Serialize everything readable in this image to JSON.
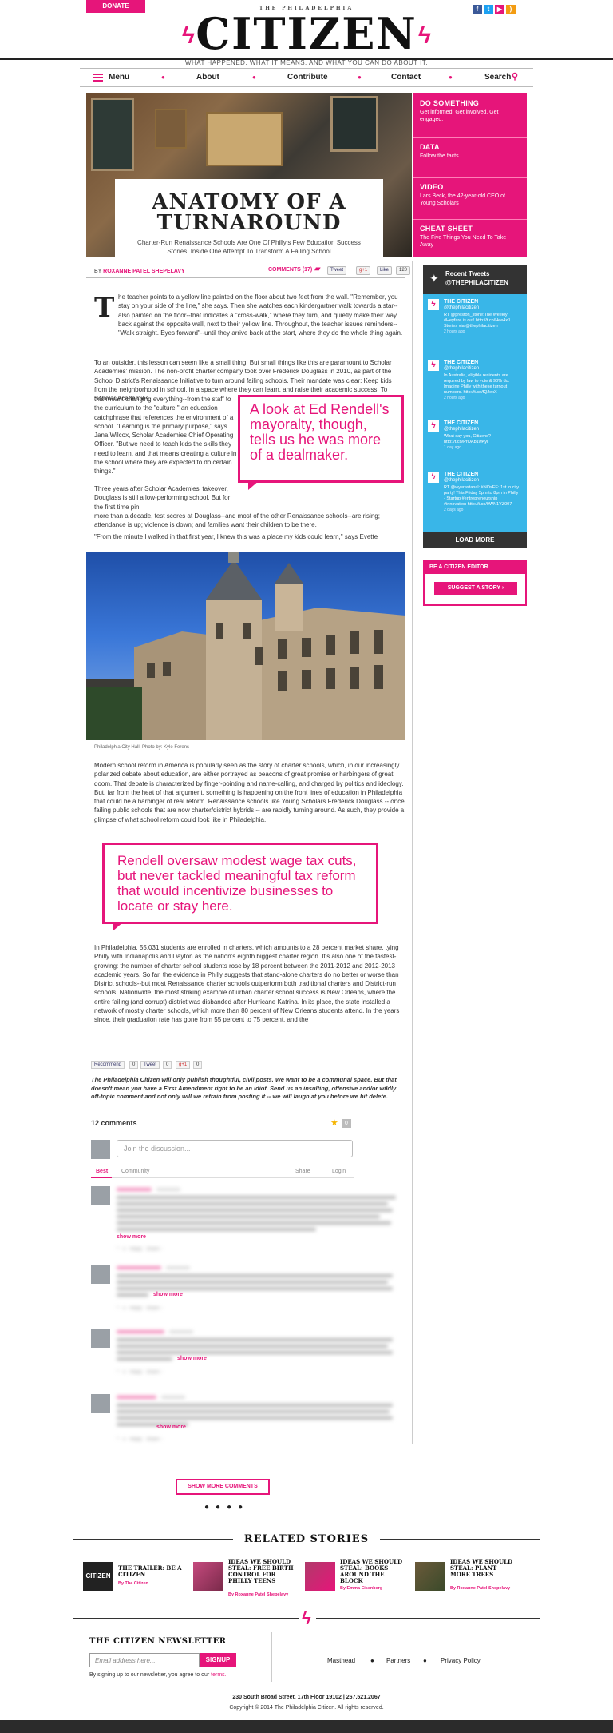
{
  "topbar": {
    "donate_label": "DONATE",
    "social": [
      {
        "name": "facebook-icon",
        "glyph": "f",
        "color": "#3b5998"
      },
      {
        "name": "twitter-icon",
        "glyph": "t",
        "color": "#1da1f2"
      },
      {
        "name": "youtube-icon",
        "glyph": "▶",
        "color": "#e6157a"
      },
      {
        "name": "rss-icon",
        "glyph": ")",
        "color": "#f39c12"
      }
    ]
  },
  "masthead": {
    "kicker": "THE PHILADELPHIA",
    "title": "CITIZEN",
    "tagline": "WHAT HAPPENED. WHAT IT MEANS. AND WHAT YOU CAN DO ABOUT IT."
  },
  "nav": {
    "menu": "Menu",
    "about": "About",
    "contribute": "Contribute",
    "contact": "Contact",
    "search": "Search"
  },
  "article": {
    "title_line1": "ANATOMY OF A",
    "title_line2": "TURNAROUND",
    "subtitle": "Charter-Run Renaissance Schools Are One Of Philly's Few Education Success Stories. Inside One Attempt To Transform A Failing School",
    "by_prefix": "BY",
    "author": "ROXANNE PATEL SHEPELAVY",
    "comments_label": "COMMENTS (17)",
    "tweet_label": "Tweet",
    "gplus_label": "g+1",
    "like_label": "Like",
    "like_count": "120",
    "dropcap": "T",
    "p1": "he teacher points to a yellow line painted on the floor about two feet from the wall. \"Remember, you stay on your side of the line,\" she says. Then she watches each kindergartner walk towards a star--also painted on the floor--that indicates a \"cross-walk,\" where they turn, and quietly make their way back against the opposite wall, next to their yellow line. Throughout, the teacher issues reminders--\"Walk straight. Eyes forward\"--until they arrive back at the start, where they do the whole thing again.",
    "p2a": "To an outsider, this lesson can seem like a small thing. But small things like this are paramount to Scholar Academies' mission. The non-profit charter company took over Frederick Douglass in 2010, as part of the School District's Renaissance Initiative to turn around failing schools. Their mandate was clear: Keep kids from the neighborhood in school, in a space where they can learn, and raise their academic success. To Scholar Academies,",
    "p2b": "this meant changing everything--from the staff to the curriculum to the \"culture,\" an education catchphrase that references the environment of a school. \"Learning is the primary purpose,\" says Jana Wilcox, Scholar Academies Chief Operating Officer. \"But we need to teach kids the skills they need to learn, and that means creating a culture in the school where they are expected to do certain things.\"",
    "p3a": "Three years after Scholar Academies' takeover, Douglass is still a low-performing school. But for the first time pin",
    "p3b": "more than a decade, test scores at Douglass--and most of the other Renaissance schools--are rising; attendance is up; violence is down; and families want their children to be there.",
    "p4": "\"From the minute I walked in that first year, I knew this was a place my kids could learn,\" says Evette",
    "pullquote1": "A look at Ed Rendell's mayoralty, though, tells us he was more of a dealmaker.",
    "photo_caption": "Philadelphia City Hall. Photo by: Kyle Ferens",
    "p5": "Modern school reform in America is popularly seen as the story of charter schools, which, in our increasingly polarized debate about education, are either portrayed as beacons of great promise or harbingers of great doom. That debate is characterized by finger-pointing and name-calling, and charged by politics and ideology. But, far from the heat of that argument, something is happening on the front lines of education in Philadelphia that could be a harbinger of real reform. Renaissance schools like Young Scholars Frederick Douglass -- once failing public schools that are now charter/district hybrids -- are rapidly turning around. As such, they provide a glimpse of what school reform could look like in Philadelphia.",
    "pullquote2": "Rendell oversaw modest wage tax cuts, but never tackled meaningful tax reform that would incentivize businesses to locate or stay here.",
    "p6": "In Philadelphia, 55,031 students are enrolled in charters, which amounts to a 28 percent market share, tying Philly with Indianapolis and Dayton as the nation's eighth biggest charter region. It's also one of the fastest-growing: the number of charter school students rose by 18 percent between the 2011-2012 and 2012-2013 academic years. So far, the evidence in Philly suggests that stand-alone charters do no better or worse than District schools--but most Renaissance charter schools outperform both traditional charters and District-run schools. Nationwide, the most striking example of urban charter school success is New Orleans, where the entire failing (and corrupt) district was disbanded after Hurricane Katrina. In its place, the state installed a network of mostly charter schools, which more than 80 percent of New Orleans students attend. In the years since, their graduation rate has gone from 55 percent to 75 percent, and the"
  },
  "side_menu": [
    {
      "heading": "DO SOMETHING",
      "desc": "Get informed. Get involved. Get engaged."
    },
    {
      "heading": "DATA",
      "desc": "Follow the facts."
    },
    {
      "heading": "VIDEO",
      "desc": "Lars Beck, the 42-year-old CEO of Young Scholars"
    },
    {
      "heading": "CHEAT SHEET",
      "desc": "The Five Things You Need To Take Away"
    }
  ],
  "twitter": {
    "heading": "Recent Tweets",
    "handle": "@THEPHILACITIZEN",
    "tweets": [
      {
        "name": "THE CITIZEN",
        "handle": "@thephilacitizen",
        "text": "RT @preston_stone:The Weekly #Heyfare is out! http://t.co/Hee4xJ Stories via @thephilacitizen",
        "time": "2 hours ago"
      },
      {
        "name": "THE CITIZEN",
        "handle": "@thephilacitizen",
        "text": "In Australia, eligible residents are required by law to vote & 90% do. Imagine Philly with these turnout numbers. http://t.co/fQJexX",
        "time": "2 hours ago"
      },
      {
        "name": "THE CITIZEN",
        "handle": "@thephilacitizen",
        "text": "What say you, Citizens? http://t.co/PrOAb1wAyi",
        "time": "1 day ago"
      },
      {
        "name": "THE CITIZEN",
        "handle": "@thephilacitizen",
        "text": "RT @wyerastanal: #NOsEE: 1st in city party! This Friday 5pm to 8pm in Philly - Startup #entrepreneurship #innovation http://t.co/9WN1YZ007",
        "time": "2 days ago"
      }
    ],
    "load_more": "LOAD MORE"
  },
  "editor": {
    "heading": "BE A CITIZEN EDITOR",
    "button": "SUGGEST A STORY"
  },
  "share_row": {
    "recommend": "Recommend",
    "recommend_count": "0",
    "tweet": "Tweet",
    "tweet_count": "0",
    "gplus": "g+1",
    "gplus_count": "0"
  },
  "policy": "The Philadelphia Citizen will only publish thoughtful, civil posts. We want to be a communal space. But that doesn't mean you have a First Amendment right to be an idiot. Send us an insulting, offensive and/or wildly off-topic comment and not only will we refrain from posting it -- we will laugh at you before we hit delete.",
  "comments": {
    "count_label": "12 comments",
    "star_count": "0",
    "input_placeholder": "Join the discussion...",
    "tab_best": "Best",
    "tab_community": "Community",
    "share": "Share",
    "login": "Login",
    "show_more": "show more",
    "show_more_comments": "SHOW MORE COMMENTS"
  },
  "related": {
    "heading": "RELATED STORIES",
    "items": [
      {
        "title": "THE TRAILER: BE A CITIZEN",
        "by": "By The Citizen",
        "thumb_color": "#222"
      },
      {
        "title": "IDEAS WE SHOULD STEAL: FREE BIRTH CONTROL FOR PHILLY TEENS",
        "by": "By Roxanne Patel Shepelavy",
        "thumb_color": "#c54a7e"
      },
      {
        "title": "IDEAS WE SHOULD STEAL: BOOKS AROUND THE BLOCK",
        "by": "By Emma Eisenberg",
        "thumb_color": "#b03a6a"
      },
      {
        "title": "IDEAS WE SHOULD STEAL: PLANT MORE TREES",
        "by": "By Roxanne Patel Shepelavy",
        "thumb_color": "#6b5a3a"
      }
    ]
  },
  "footer": {
    "newsletter_heading": "THE CITIZEN NEWSLETTER",
    "email_placeholder": "Email address here...",
    "signup": "SIGNUP",
    "terms_prefix": "By signing up to our newsletter, you agree to our",
    "terms_link": "terms.",
    "links": [
      "Masthead",
      "Partners",
      "Privacy Policy"
    ],
    "address": "230 South Broad Street, 17th Floor 19102 | 267.521.2067",
    "copyright": "Copyright © 2014 The Philadelphia Citizen. All rights reserved."
  },
  "colors": {
    "accent": "#e6157a",
    "twitter_bg": "#39b6e8",
    "dark": "#333333"
  }
}
